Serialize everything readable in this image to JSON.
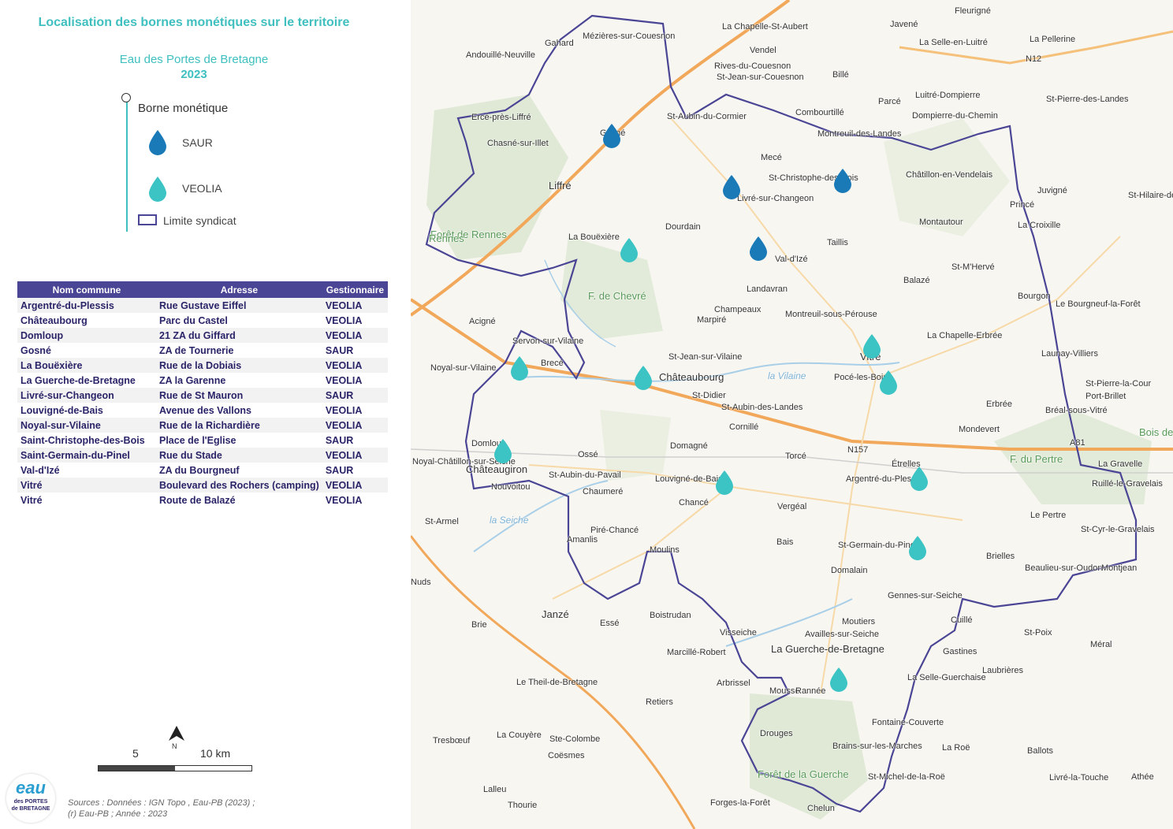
{
  "title": "Localisation des bornes monétiques sur le territoire",
  "subtitle": "Eau des Portes de Bretagne",
  "year": "2023",
  "legend": {
    "title": "Borne monétique",
    "saur": "SAUR",
    "veolia": "VEOLIA",
    "limit": "Limite syndicat",
    "saur_color": "#1a7ab8",
    "veolia_color": "#3cc4c4",
    "limit_color": "#4a4594"
  },
  "table": {
    "headers": [
      "Nom commune",
      "Adresse",
      "Gestionnaire"
    ],
    "rows": [
      [
        "Argentré-du-Plessis",
        "Rue Gustave Eiffel",
        "VEOLIA"
      ],
      [
        "Châteaubourg",
        "Parc du Castel",
        "VEOLIA"
      ],
      [
        "Domloup",
        "21 ZA du Giffard",
        "VEOLIA"
      ],
      [
        "Gosné",
        "ZA de Tournerie",
        "SAUR"
      ],
      [
        "La Bouëxière",
        "Rue de la Dobiais",
        "VEOLIA"
      ],
      [
        "La Guerche-de-Bretagne",
        "ZA la Garenne",
        "VEOLIA"
      ],
      [
        "Livré-sur-Changeon",
        "Rue de St Mauron",
        "SAUR"
      ],
      [
        "Louvigné-de-Bais",
        "Avenue des Vallons",
        "VEOLIA"
      ],
      [
        "Noyal-sur-Vilaine",
        "Rue de la Richardière",
        "VEOLIA"
      ],
      [
        "Saint-Christophe-des-Bois",
        "Place de l'Eglise",
        "SAUR"
      ],
      [
        "Saint-Germain-du-Pinel",
        "Rue du Stade",
        "VEOLIA"
      ],
      [
        "Val-d'Izé",
        "ZA du Bourgneuf",
        "SAUR"
      ],
      [
        "Vitré",
        "Boulevard des Rochers (camping)",
        "VEOLIA"
      ],
      [
        "Vitré",
        "Route de Balazé",
        "VEOLIA"
      ]
    ]
  },
  "scale": {
    "mid": "5",
    "end": "10 km",
    "north": "N"
  },
  "sources": {
    "line1": "Sources : Données : IGN Topo , Eau-PB (2023) ;",
    "line2": "(r) Eau-PB ; Année : 2023"
  },
  "logo": {
    "main": "eau",
    "sub1": "des PORTES",
    "sub2": "de BRETAGNE"
  },
  "places": [
    "Fleurigné",
    "Javené",
    "La Selle-en-Luitré",
    "La Pellerine",
    "Gahard",
    "Mézières-sur-Couesnon",
    "La Chapelle-St-Aubert",
    "Vendel",
    "Rives-du-Couesnon",
    "St-Jean-sur-Couesnon",
    "Billé",
    "Andouillé-Neuville",
    "Luitré-Dompierre",
    "St-Pierre-des-Landes",
    "St-Aubin-du-Cormier",
    "Combourtillé",
    "Parcé",
    "Dompierre-du-Chemin",
    "Ercé-près-Liffré",
    "Gosné",
    "Chasné-sur-Illet",
    "Montreuil-des-Landes",
    "Mecé",
    "St-Christophe-des-Bois",
    "Livré-sur-Changeon",
    "Châtillon-en-Vendelais",
    "Juvigné",
    "St-Hilaire-des-Landes",
    "Liffré",
    "Forêt de Rennes",
    "La Bouëxière",
    "Dourdain",
    "Taillis",
    "Montautour",
    "Princé",
    "La Croixille",
    "Val-d'Izé",
    "St-M'Hervé",
    "Balazé",
    "Landavran",
    "Bourgon",
    "Le Bourgneuf-la-Forêt",
    "Acigné",
    "Champeaux",
    "Marpiré",
    "Montreuil-sous-Pérouse",
    "Servon-sur-Vilaine",
    "Brecé",
    "Noyal-sur-Vilaine",
    "St-Jean-sur-Vilaine",
    "Châteaubourg",
    "Vitré",
    "La Chapelle-Erbrée",
    "Launay-Villiers",
    "Pocé-les-Bois",
    "St-Didier",
    "St-Aubin-des-Landes",
    "Cornillé",
    "Erbrée",
    "St-Pierre-la-Cour",
    "Port-Brillet",
    "Bréal-sous-Vitré",
    "Mondevert",
    "Domagné",
    "Domloup",
    "Châteaugiron",
    "Noyal-Châtillon-sur-Seiche",
    "Nouvoitou",
    "Ossé",
    "St-Aubin-du-Pavail",
    "Chaumeré",
    "Louvigné-de-Bais",
    "Chancé",
    "Torcé",
    "Étrelles",
    "Argentré-du-Plessis",
    "La Gravelle",
    "Ruillé-le-Gravelais",
    "Vergéal",
    "St-Armel",
    "Piré-Chancé",
    "Amanlis",
    "Bais",
    "St-Germain-du-Pinel",
    "Le Pertre",
    "St-Cyr-le-Gravelais",
    "Moulins",
    "Domalain",
    "Brielles",
    "Beaulieu-sur-Oudon",
    "Montjean",
    "Gennes-sur-Seiche",
    "Janzé",
    "Boistrudan",
    "Brie",
    "Essé",
    "Visseiche",
    "Moutiers",
    "Availles-sur-Seiche",
    "Cuillé",
    "St-Poix",
    "Marcillé-Robert",
    "La Guerche-de-Bretagne",
    "Gastines",
    "Méral",
    "Laubrières",
    "La Selle-Guerchaise",
    "Arbrissel",
    "Mousse",
    "Rannée",
    "Le Theil-de-Bretagne",
    "Retiers",
    "Fontaine-Couverte",
    "Drouges",
    "Brains-sur-les-Marches",
    "St-Michel-de-la-Roë",
    "La Roë",
    "Ballots",
    "Tresbœuf",
    "La Couyère",
    "Ste-Colombe",
    "Coësmes",
    "Livré-la-Touche",
    "Athée",
    "Forêt de la Guerche",
    "Lalleu",
    "Thourie",
    "Forges-la-Forêt",
    "Chelun",
    "Rennes",
    "Nuds",
    "F. de Chevré",
    "la Vilaine",
    "la Seiche",
    "Bois de Gravelles",
    "F. du Pertre",
    "N157",
    "N12",
    "A81"
  ]
}
